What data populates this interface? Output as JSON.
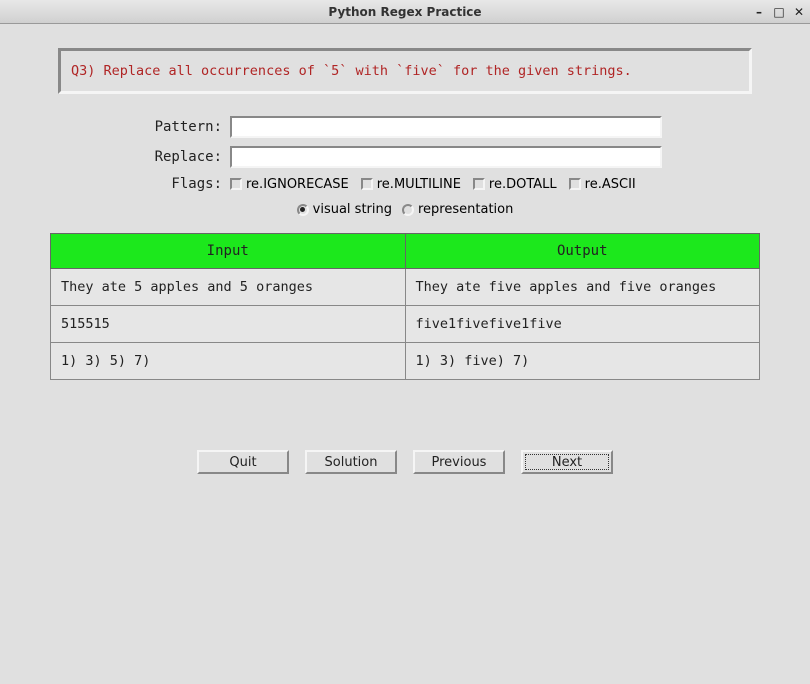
{
  "window": {
    "title": "Python Regex Practice"
  },
  "question": {
    "text": "Q3) Replace all occurrences of `5` with `five` for the given strings."
  },
  "labels": {
    "pattern": "Pattern:",
    "replace": "Replace:",
    "flags": "Flags:"
  },
  "inputs": {
    "pattern_value": "",
    "replace_value": ""
  },
  "flags": {
    "ignorecase": "re.IGNORECASE",
    "multiline": "re.MULTILINE",
    "dotall": "re.DOTALL",
    "ascii": "re.ASCII"
  },
  "display_mode": {
    "visual": "visual string",
    "repr": "representation"
  },
  "table": {
    "headers": {
      "input": "Input",
      "output": "Output"
    },
    "rows": [
      {
        "input": "They ate 5 apples and 5 oranges",
        "output": "They ate five apples and five oranges"
      },
      {
        "input": "515515",
        "output": "five1fivefive1five"
      },
      {
        "input": "1) 3) 5) 7)",
        "output": "1) 3) five) 7)"
      }
    ]
  },
  "buttons": {
    "quit": "Quit",
    "solution": "Solution",
    "previous": "Previous",
    "next": "Next"
  }
}
